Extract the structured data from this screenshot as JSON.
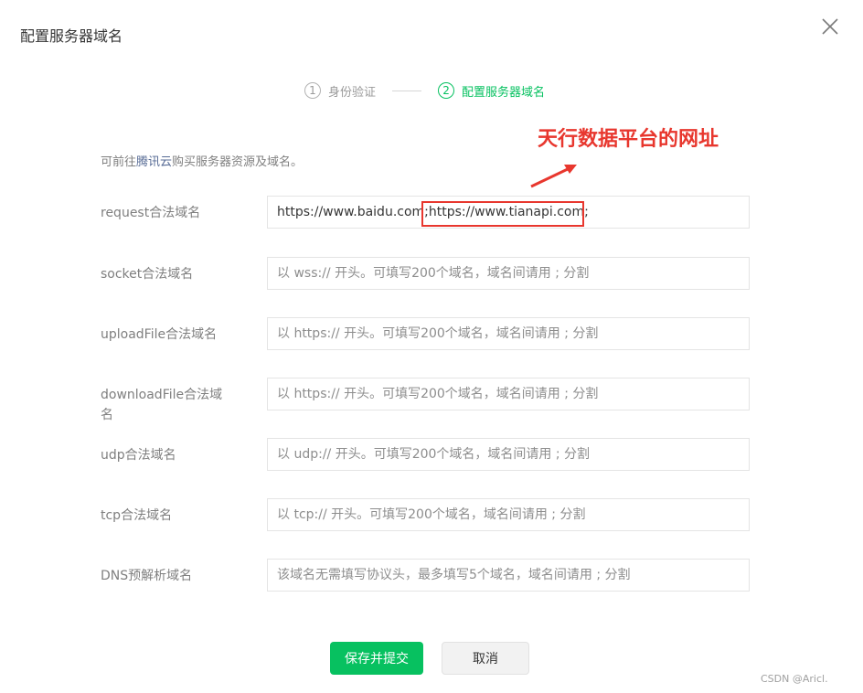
{
  "dialog": {
    "title": "配置服务器域名",
    "close_icon": "close-icon"
  },
  "steps": [
    {
      "number": "1",
      "label": "身份验证",
      "state": "inactive"
    },
    {
      "number": "2",
      "label": "配置服务器域名",
      "state": "active"
    }
  ],
  "hint": {
    "prefix": "可前往",
    "link": "腾讯云",
    "suffix": "购买服务器资源及域名。"
  },
  "annotation": {
    "text": "天行数据平台的网址",
    "color": "#e8372e"
  },
  "fields": [
    {
      "label": "request合法域名",
      "value": "https://www.baidu.com;https://www.tianapi.com;",
      "placeholder": ""
    },
    {
      "label": "socket合法域名",
      "value": "",
      "placeholder": "以 wss:// 开头。可填写200个域名，域名间请用 ; 分割"
    },
    {
      "label": "uploadFile合法域名",
      "value": "",
      "placeholder": "以 https:// 开头。可填写200个域名，域名间请用 ; 分割"
    },
    {
      "label": "downloadFile合法域名",
      "value": "",
      "placeholder": "以 https:// 开头。可填写200个域名，域名间请用 ; 分割"
    },
    {
      "label": "udp合法域名",
      "value": "",
      "placeholder": "以 udp:// 开头。可填写200个域名，域名间请用 ; 分割"
    },
    {
      "label": "tcp合法域名",
      "value": "",
      "placeholder": "以 tcp:// 开头。可填写200个域名，域名间请用 ; 分割"
    },
    {
      "label": "DNS预解析域名",
      "value": "",
      "placeholder": "该域名无需填写协议头，最多填写5个域名，域名间请用 ; 分割"
    }
  ],
  "buttons": {
    "submit": "保存并提交",
    "cancel": "取消"
  },
  "watermark": "CSDN @Aricl.",
  "colors": {
    "accent": "#07c160",
    "link": "#576b95",
    "annotation": "#e8372e"
  }
}
